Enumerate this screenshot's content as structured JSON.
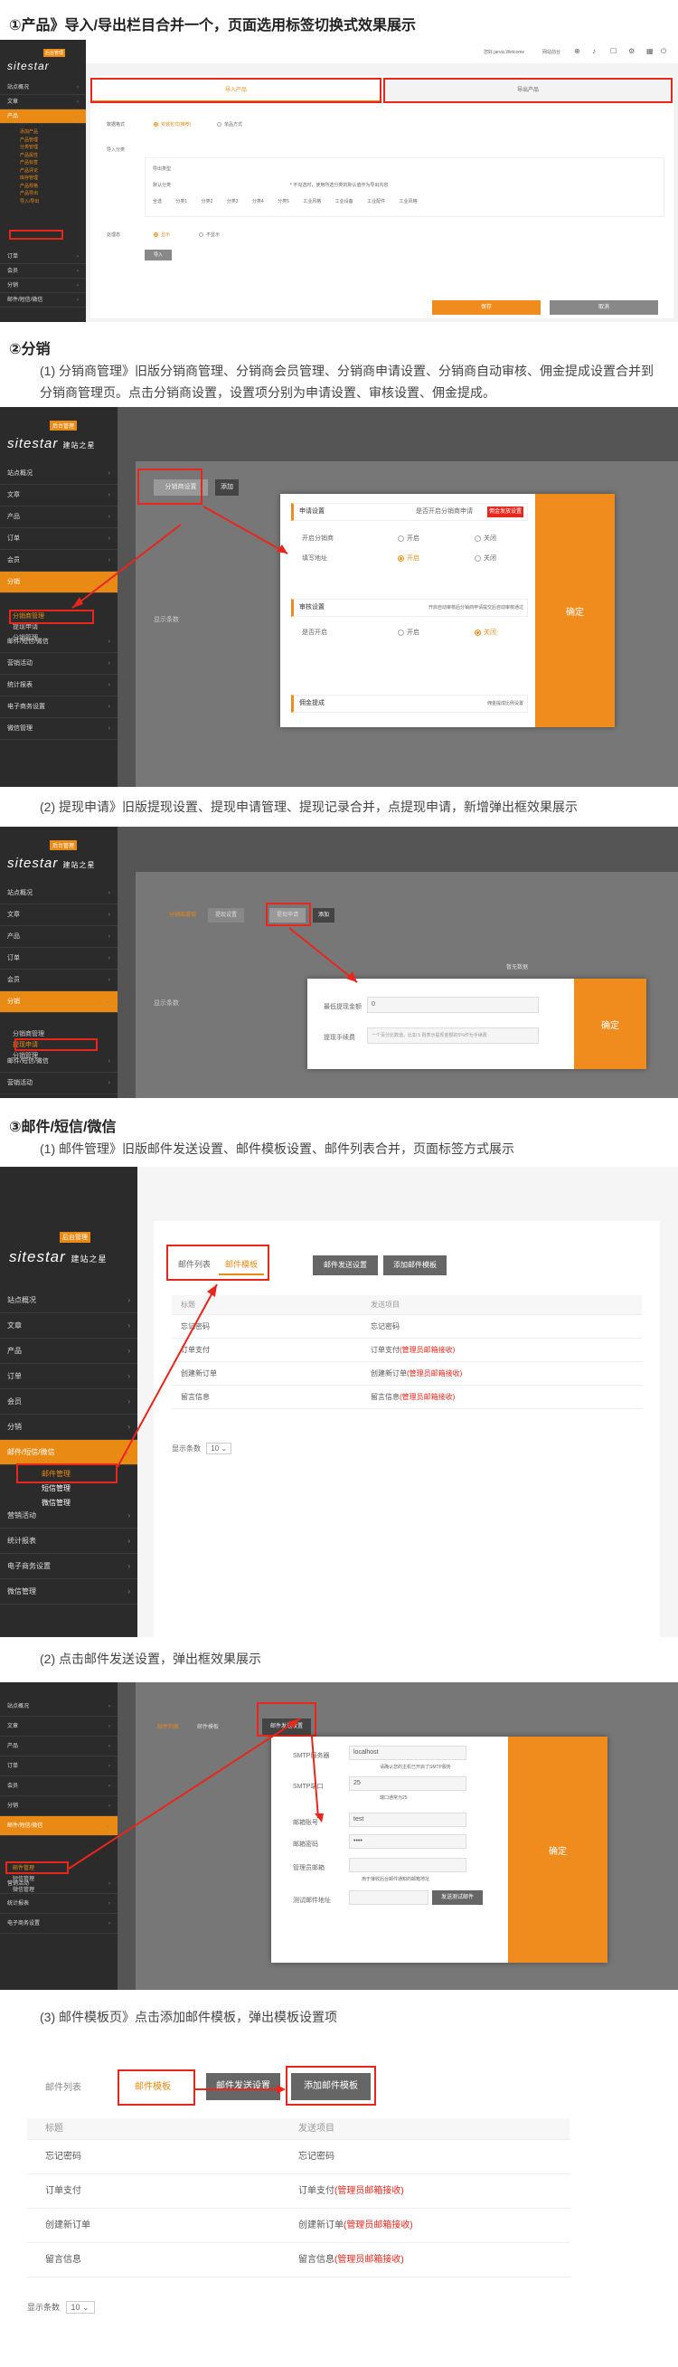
{
  "sections": {
    "s1_title": "①产品》导入/导出栏目合并一个，页面选用标签切换式效果展示",
    "s2_title": "②分销",
    "s2_desc1": "(1) 分销商管理》旧版分销商管理、分销商会员管理、分销商申请设置、分销商自动审核、佣金提成设置合并到分销商管理页。点击分销商设置，设置项分别为申请设置、审核设置、佣金提成。",
    "s2_desc2": "(2) 提现申请》旧版提现设置、提现申请管理、提现记录合并，点提现申请，新增弹出框效果展示",
    "s3_title": "③邮件/短信/微信",
    "s3_desc1": "(1) 邮件管理》旧版邮件发送设置、邮件模板设置、邮件列表合并，页面标签方式展示",
    "s3_desc2": "(2) 点击邮件发送设置，弹出框效果展示",
    "s3_desc3": "(3) 邮件模板页》点击添加邮件模板，弹出模板设置项"
  },
  "shot1": {
    "logo": "sitestar",
    "logo_badge": "后台管理",
    "top_user": "您好,jarvis,Welcome",
    "top_site": "网站前台",
    "nav": [
      "站点概况",
      "文章",
      "产品",
      "订单",
      "会员",
      "分销",
      "邮件/短信/微信"
    ],
    "product_sub": [
      "添加产品",
      "产品管理",
      "分类管理",
      "产品属性",
      "产品标签",
      "产品评论",
      "库存管理",
      "产品规格",
      "产品导出",
      "导入/导出"
    ],
    "tabs": [
      "导入产品",
      "导出产品"
    ],
    "rows": {
      "format_label": "数据格式",
      "format_opt1": "安装包式(推荐)",
      "format_opt2": "单品方式",
      "category_label": "导入分类",
      "type_label": "导出类型",
      "default_label": "默认分类",
      "status_label": "处理态",
      "status_opt1": "显示",
      "status_opt2": "不显示",
      "note": "* 不勾选时，使用所选分类的默认值作为导出内容",
      "cats": [
        "全选",
        "分类1",
        "分类2",
        "分类3",
        "分类4",
        "分类5",
        "工业风格",
        "工业设备",
        "工业配件",
        "工业风格"
      ]
    },
    "save": "保存",
    "cancel": "取消",
    "submit": "导入"
  },
  "shot2": {
    "logo": "sitestar",
    "logo_cn": "建站之星",
    "badge": "后台管理",
    "nav": [
      "站点概况",
      "文章",
      "产品",
      "订单",
      "会员",
      "分销",
      "邮件/短信/微信",
      "营销活动",
      "统计报表",
      "电子商务设置",
      "微信管理"
    ],
    "sub": [
      "分销商管理",
      "提现申请",
      "分销管理"
    ],
    "tabs": [
      "分销商设置",
      "添加"
    ],
    "modal": {
      "sec1": "申请设置",
      "sec1_hint": "是否开启分销商申请",
      "sec1_badge": "佣金发放设置",
      "row1_label": "开启分销商",
      "row1_on": "开启",
      "row1_off": "关闭",
      "row2_label": "填写地址",
      "row2_on": "开启",
      "row2_off": "关闭",
      "sec2": "审核设置",
      "sec2_hint": "开启自动审核后分销商申请提交后自动审核通过",
      "row3_label": "是否开启",
      "row3_on": "开启",
      "row3_off": "关闭",
      "sec3": "佣金提成",
      "sec3_hint": "佣金提成比例设置",
      "confirm": "确定"
    },
    "pager": "显示条数"
  },
  "shot3": {
    "logo": "sitestar",
    "logo_cn": "建站之星",
    "badge": "后台管理",
    "nav": [
      "站点概况",
      "文章",
      "产品",
      "订单",
      "会员",
      "分销",
      "邮件/短信/微信",
      "营销活动",
      "统计报表",
      "电子商务设置",
      "微信管理"
    ],
    "sub": [
      "分销商管理",
      "提现申请",
      "分销管理"
    ],
    "tabs": [
      "分销商提现",
      "提现设置",
      "提现申请",
      "添加"
    ],
    "empty": "暂无数据",
    "modal": {
      "row1_label": "最低提现金额",
      "row1_val": "0",
      "row2_label": "提现手续费",
      "row2_ph": "一个百分比数值，比如 5 则表示提现金额的5%作为手续费",
      "confirm": "确定"
    },
    "pager": "显示条数"
  },
  "shot4": {
    "logo": "sitestar",
    "logo_cn": "建站之星",
    "badge": "后台管理",
    "nav": [
      "站点概况",
      "文章",
      "产品",
      "订单",
      "会员",
      "分销",
      "邮件/短信/微信",
      "营销活动",
      "统计报表",
      "电子商务设置",
      "微信管理"
    ],
    "sub": [
      "邮件管理",
      "短信管理",
      "微信管理"
    ],
    "tabs": [
      "邮件列表",
      "邮件模板",
      "邮件发送设置",
      "添加邮件模板"
    ],
    "head": [
      "标题",
      "发送项目"
    ],
    "rows": [
      {
        "title": "忘记密码",
        "item": "忘记密码",
        "extra": ""
      },
      {
        "title": "订单支付",
        "item": "订单支付",
        "extra": "(管理员邮箱接收)"
      },
      {
        "title": "创建新订单",
        "item": "创建新订单",
        "extra": "(管理员邮箱接收)"
      },
      {
        "title": "留言信息",
        "item": "留言信息",
        "extra": "(管理员邮箱接收)"
      }
    ],
    "pager": "显示条数",
    "pager_val": "10"
  },
  "shot5": {
    "logo": "sitestar",
    "logo_cn": "建站之星",
    "badge": "后台管理",
    "nav": [
      "站点概况",
      "文章",
      "产品",
      "订单",
      "会员",
      "分销",
      "邮件/短信/微信",
      "营销活动",
      "统计报表",
      "电子商务设置"
    ],
    "sub": [
      "邮件管理",
      "短信管理",
      "微信管理"
    ],
    "tabs": [
      "邮件列表",
      "邮件模板",
      "邮件发送设置"
    ],
    "modal": {
      "r1": "SMTP服务器",
      "r1v": "localhost",
      "r1h": "请确认您的主机已开启了SMTP服务",
      "r2": "SMTP端口",
      "r2v": "25",
      "r2h": "端口通常为25",
      "r3": "邮箱账号",
      "r3v": "test",
      "r4": "邮箱密码",
      "r4v": "••••",
      "r5": "管理员邮箱",
      "r5h": "用于接收后台邮件通知的邮箱地址",
      "r6": "测试邮件地址",
      "r6b": "发送测试邮件",
      "confirm": "确定"
    }
  },
  "shot6": {
    "tabs": [
      "邮件列表",
      "邮件模板",
      "邮件发送设置",
      "添加邮件模板"
    ],
    "head": [
      "标题",
      "发送项目"
    ],
    "rows": [
      {
        "title": "忘记密码",
        "item": "忘记密码",
        "extra": ""
      },
      {
        "title": "订单支付",
        "item": "订单支付",
        "extra": "(管理员邮箱接收)"
      },
      {
        "title": "创建新订单",
        "item": "创建新订单",
        "extra": "(管理员邮箱接收)"
      },
      {
        "title": "留言信息",
        "item": "留言信息",
        "extra": "(管理员邮箱接收)"
      }
    ],
    "pager": "显示条数",
    "pager_val": "10"
  },
  "colors": {
    "accent": "#f08c1d",
    "red": "#e8261c",
    "sidebar": "#2b2b2b"
  }
}
